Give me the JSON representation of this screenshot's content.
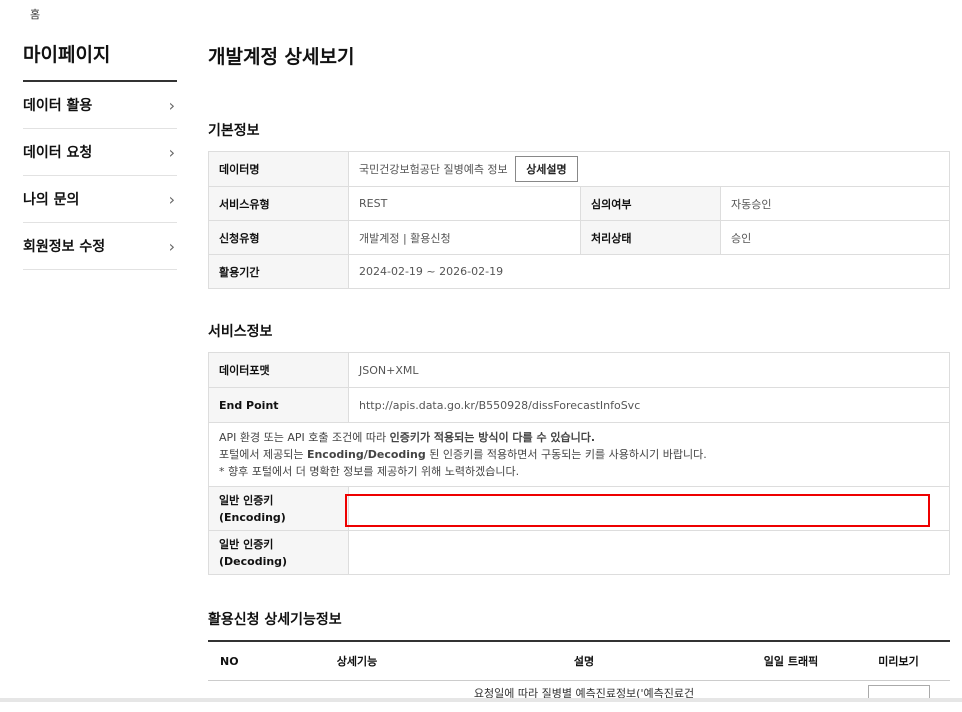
{
  "breadcrumb": "홈",
  "sidebar": {
    "title": "마이페이지",
    "items": [
      {
        "label": "데이터 활용"
      },
      {
        "label": "데이터 요청"
      },
      {
        "label": "나의 문의"
      },
      {
        "label": "회원정보 수정"
      }
    ]
  },
  "page_title": "개발계정 상세보기",
  "basic": {
    "title": "기본정보",
    "data_name_label": "데이터명",
    "data_name_value": "국민건강보험공단 질병예측 정보",
    "detail_button": "상세설명",
    "service_type_label": "서비스유형",
    "service_type_value": "REST",
    "review_label": "심의여부",
    "review_value": "자동승인",
    "apply_type_label": "신청유형",
    "apply_type_value": "개발계정 | 활용신청",
    "status_label": "처리상태",
    "status_value": "승인",
    "period_label": "활용기간",
    "period_value": "2024-02-19 ~ 2026-02-19"
  },
  "service": {
    "title": "서비스정보",
    "format_label": "데이터포맷",
    "format_value": "JSON+XML",
    "endpoint_label": "End Point",
    "endpoint_value": "http://apis.data.go.kr/B550928/dissForecastInfoSvc",
    "note_line1_prefix": "API 환경 또는 API 호출 조건에 따라 ",
    "note_line1_bold": "인증키가 적용되는 방식이 다를 수 있습니다.",
    "note_line2_prefix": "포털에서 제공되는 ",
    "note_line2_bold": "Encoding/Decoding",
    "note_line2_suffix": " 된 인증키를 적용하면서 구동되는 키를 사용하시기 바랍니다.",
    "note_line3": "* 향후 포털에서 더 명확한 정보를 제공하기 위해 노력하겠습니다.",
    "enc_label_1": "일반 인증키",
    "enc_label_2": "(Encoding)",
    "enc_value": "",
    "dec_label_1": "일반 인증키",
    "dec_label_2": "(Decoding)",
    "dec_value": ""
  },
  "features": {
    "title": "활용신청 상세기능정보",
    "headers": [
      "NO",
      "상세기능",
      "설명",
      "일일 트래픽",
      "미리보기"
    ],
    "row1_desc": "요청일에 따라 질병별 예측진료정보('예측진료건"
  },
  "colors": {
    "highlight": "#e00000",
    "label_bg": "#f6f6f6"
  }
}
